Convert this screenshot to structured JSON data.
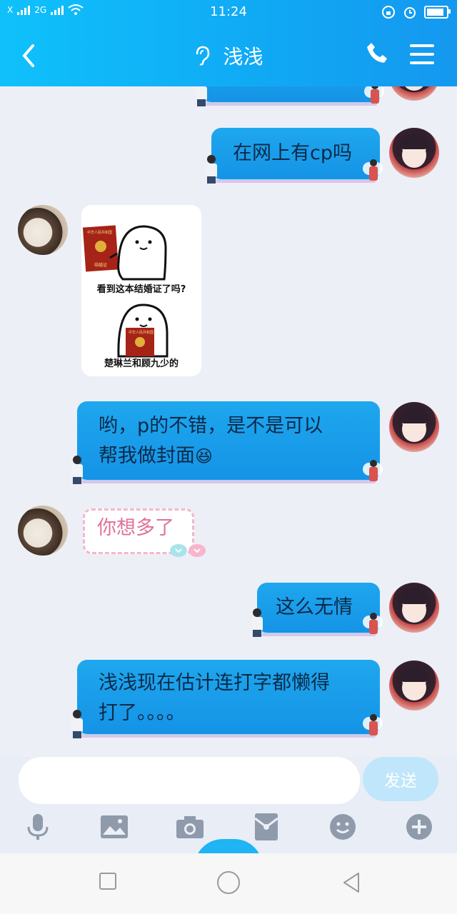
{
  "status": {
    "sim": "X",
    "network": "2G",
    "time": "11:24",
    "battery_level": 0.9
  },
  "header": {
    "title": "浅浅",
    "title_icon": "ear-icon",
    "back_icon": "chevron-left-icon",
    "call_icon": "phone-icon",
    "menu_icon": "hamburger-menu-icon"
  },
  "messages": [
    {
      "side": "right",
      "type": "text",
      "text": "在网上有cp吗"
    },
    {
      "side": "left",
      "type": "sticker",
      "caption_top": "看到这本结婚证了吗?",
      "caption_bottom": "楚琳兰和顾九少的",
      "book_title": "中华人民共和国",
      "book_label": "结婚证"
    },
    {
      "side": "right",
      "type": "text",
      "line1": "哟，p的不错，是不是可以",
      "line2": "帮我做封面",
      "emoji": "😆"
    },
    {
      "side": "left",
      "type": "text",
      "text": "你想多了"
    },
    {
      "side": "right",
      "type": "text",
      "text": "这么无情"
    },
    {
      "side": "right",
      "type": "text",
      "line1": "浅浅现在估计连打字都懒得",
      "line2": "打了。。。。"
    }
  ],
  "composer": {
    "input_value": "",
    "send_label": "发送"
  },
  "toolbar": [
    "microphone-icon",
    "image-icon",
    "camera-icon",
    "red-packet-icon",
    "emoji-icon",
    "plus-icon"
  ],
  "colors": {
    "header": "#10a8f4",
    "bubble_blue": "#1593e6",
    "pink_text": "#e0709a",
    "chat_bg": "#eceff6"
  }
}
